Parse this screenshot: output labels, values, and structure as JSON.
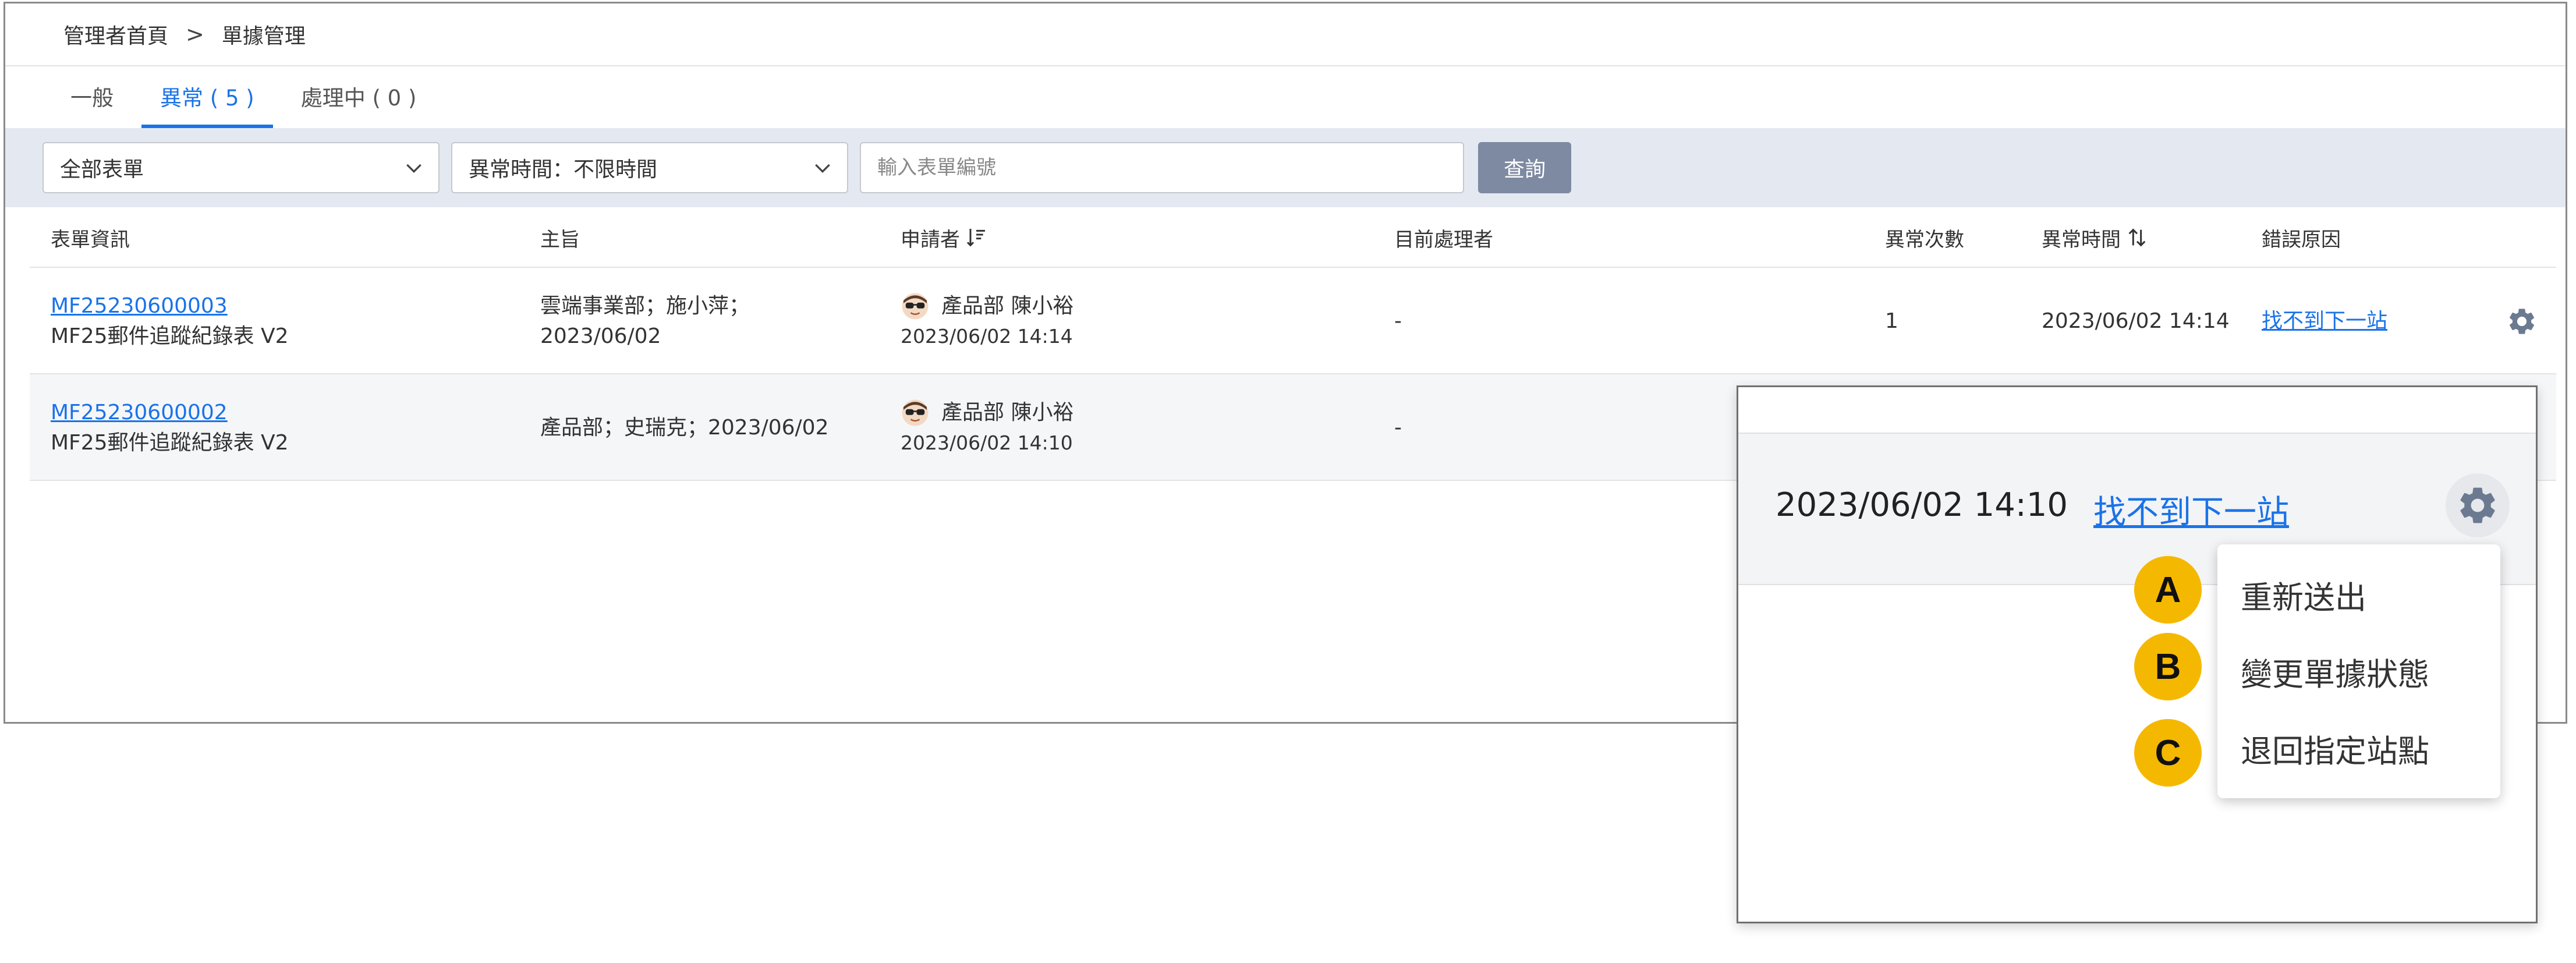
{
  "breadcrumb": {
    "home": "管理者首頁",
    "separator": ">",
    "current": "單據管理"
  },
  "tabs": [
    {
      "label": "一般",
      "active": false
    },
    {
      "label": "異常 ( 5 )",
      "active": true
    },
    {
      "label": "處理中 ( 0 )",
      "active": false
    }
  ],
  "filters": {
    "form_select": "全部表單",
    "time_select": "異常時間：不限時間",
    "search_placeholder": "輸入表單編號",
    "query_label": "查詢"
  },
  "table": {
    "headers": {
      "form_info": "表單資訊",
      "subject": "主旨",
      "applicant": "申請者",
      "handler": "目前處理者",
      "count": "異常次數",
      "time": "異常時間",
      "reason": "錯誤原因"
    },
    "rows": [
      {
        "form_id": "MF25230600003",
        "form_name": "MF25郵件追蹤紀錄表 V2",
        "subject_line1": "雲端事業部；施小萍；",
        "subject_line2": "2023/06/02",
        "applicant": "產品部 陳小裕",
        "applied_time": "2023/06/02 14:14",
        "handler": "-",
        "count": "1",
        "time": "2023/06/02 14:14",
        "reason": "找不到下一站"
      },
      {
        "form_id": "MF25230600002",
        "form_name": "MF25郵件追蹤紀錄表 V2",
        "subject_line1": "產品部；史瑞克；2023/06/02",
        "subject_line2": "",
        "applicant": "產品部 陳小裕",
        "applied_time": "2023/06/02 14:10",
        "handler": "-"
      }
    ]
  },
  "zoom": {
    "time": "2023/06/02 14:10",
    "reason": "找不到下一站",
    "menu": [
      {
        "badge": "A",
        "label": "重新送出"
      },
      {
        "badge": "B",
        "label": "變更單據狀態"
      },
      {
        "badge": "C",
        "label": "退回指定站點"
      }
    ]
  },
  "colors": {
    "accent": "#1a73e8",
    "filter_bg": "#e4e9f1",
    "query_button": "#7e8aa2",
    "badge": "#f5b800"
  }
}
